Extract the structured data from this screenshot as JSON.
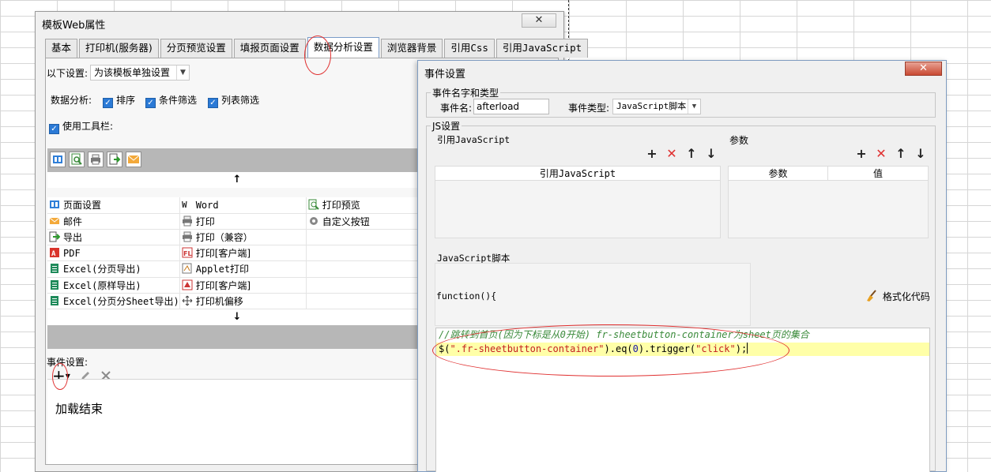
{
  "main_window": {
    "title": "模板Web属性",
    "close_symbol": "✕",
    "tabs": [
      {
        "label": "基本"
      },
      {
        "label": "打印机(服务器)"
      },
      {
        "label": "分页预览设置"
      },
      {
        "label": "填报页面设置"
      },
      {
        "label": "数据分析设置",
        "active": true
      },
      {
        "label": "浏览器背景"
      },
      {
        "label": "引用Css"
      },
      {
        "label": "引用JavaScript"
      }
    ],
    "settings_label": "以下设置:",
    "settings_value": "为该模板单独设置",
    "analysis_label": "数据分析:",
    "check_sort": "排序",
    "check_condition_filter": "条件筛选",
    "check_list_filter": "列表筛选",
    "use_toolbar_label": "使用工具栏:",
    "up_arrow": "↑",
    "down_arrow": "↓",
    "buttons": [
      [
        "页面设置",
        "Word",
        "打印预览"
      ],
      [
        "邮件",
        "打印",
        "自定义按钮"
      ],
      [
        "导出",
        "打印（兼容）",
        ""
      ],
      [
        "PDF",
        "打印[客户端]",
        ""
      ],
      [
        "Excel(分页导出)",
        "Applet打印",
        ""
      ],
      [
        "Excel(原样导出)",
        "打印[客户端]",
        ""
      ],
      [
        "Excel(分页分Sheet导出)",
        "打印机偏移",
        ""
      ]
    ],
    "event_settings_label": "事件设置:",
    "add_symbol": "+",
    "event_item": "加载结束"
  },
  "dialog": {
    "title": "事件设置",
    "close_symbol": "✕",
    "group_name_type": "事件名字和类型",
    "event_name_label": "事件名:",
    "event_name_value": "afterload",
    "event_type_label": "事件类型:",
    "event_type_value": "JavaScript脚本",
    "js_group": "JS设置",
    "ref_js_label": "引用JavaScript",
    "params_label": "参数",
    "ref_js_column": "引用JavaScript",
    "param_column": "参数",
    "value_column": "值",
    "script_label": "JavaScript脚本",
    "function_signature": "function(){",
    "format_code_label": "格式化代码",
    "code_comment": "//跳转到首页(因为下标是从0开始) fr-sheetbutton-container为sheet页的集合",
    "code_line_prefix": "$(",
    "code_line_string1": "\".fr-sheetbutton-container\"",
    "code_line_mid1": ").eq(",
    "code_line_number": "0",
    "code_line_mid2": ").trigger(",
    "code_line_string2": "\"click\"",
    "code_line_suffix": ");"
  },
  "colors": {
    "annotation": "#e03030",
    "code_comment": "#3a8a3a",
    "code_string": "#c42020",
    "code_number": "#1a1aa6",
    "highlight_line": "#ffffa8",
    "delete_red": "#e03030"
  }
}
